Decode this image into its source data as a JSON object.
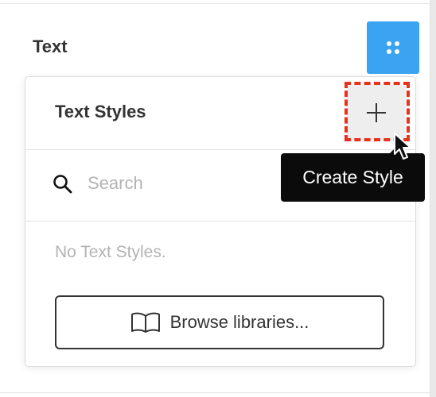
{
  "section": {
    "title": "Text",
    "grid_button_icon": "grid-dots-icon"
  },
  "popover": {
    "title": "Text Styles",
    "add_button_icon": "plus-icon",
    "search": {
      "icon": "search-icon",
      "placeholder": "Search",
      "value": ""
    },
    "empty_message": "No Text Styles.",
    "browse_button": {
      "icon": "book-icon",
      "label": "Browse libraries..."
    }
  },
  "tooltip": {
    "text": "Create Style"
  },
  "colors": {
    "accent": "#3aa3f2",
    "highlight": "#e8311c",
    "tooltip_bg": "#0b0b0b",
    "muted_text": "#b3b3b3"
  }
}
